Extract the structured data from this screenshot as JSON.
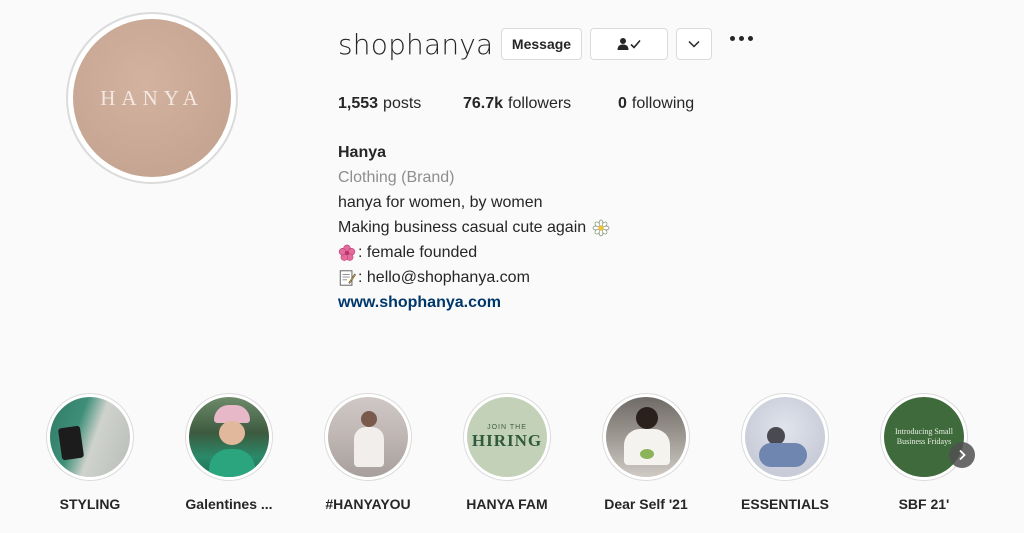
{
  "profile": {
    "avatar_logo_text": "HANYA",
    "username": "shophanya",
    "message_label": "Message"
  },
  "stats": {
    "posts_count": "1,553",
    "posts_label": "posts",
    "followers_count": "76.7k",
    "followers_label": "followers",
    "following_count": "0",
    "following_label": "following"
  },
  "bio": {
    "name": "Hanya",
    "category": "Clothing (Brand)",
    "line1": "hanya for women, by women",
    "line2": "Making business casual cute again",
    "line3": ": female founded",
    "line4": ": hello@shophanya.com",
    "website": "www.shophanya.com"
  },
  "icons": {
    "follow_state": "person-check-icon",
    "dropdown": "chevron-down-icon",
    "more": "more-options-icon",
    "next": "chevron-right-icon",
    "daisy_emoji": "daisy-emoji",
    "flower_emoji": "hibiscus-emoji",
    "memo_emoji": "memo-emoji"
  },
  "highlights": [
    {
      "label": "STYLING"
    },
    {
      "label": "Galentines ..."
    },
    {
      "label": "#HANYAYOU"
    },
    {
      "label": "HANYA FAM"
    },
    {
      "label": "Dear Self '21"
    },
    {
      "label": "ESSENTIALS"
    },
    {
      "label": "SBF 21'"
    }
  ],
  "highlight_art": {
    "hanya_fam_top": "JOIN THE",
    "hanya_fam_main": "HIRING",
    "sbf_line1": "Introducing Small",
    "sbf_line2": "Business Fridays"
  },
  "colors": {
    "link": "#00376b",
    "category": "#8e8e8e",
    "avatar": "#c9a895"
  }
}
